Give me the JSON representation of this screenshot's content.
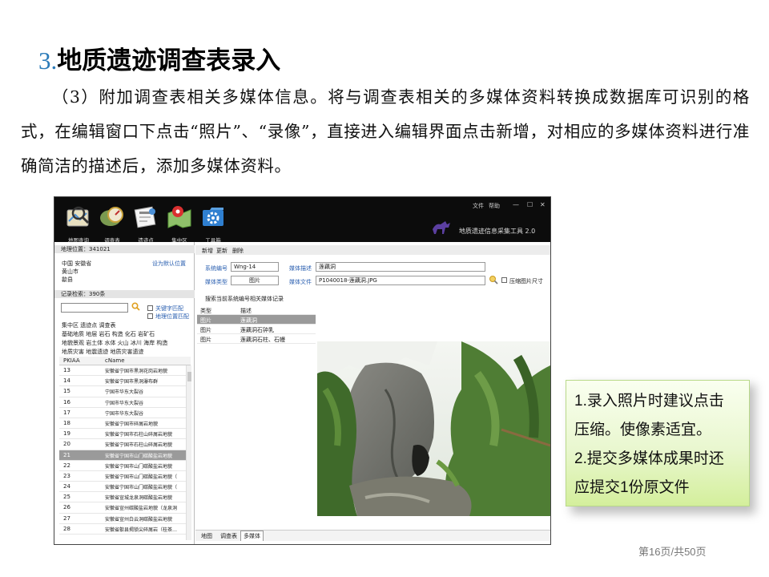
{
  "slide": {
    "title_num": "3.",
    "title_text": "地质遗迹调查表录入",
    "paragraph": "（3）附加调查表相关多媒体信息。将与调查表相关的多媒体资料转换成数据库可识别的格式，在编辑窗口下点击“照片”、“录像”，直接进入编辑界面点击新增，对相应的多媒体资料进行准确简洁的描述后，添加多媒体资料。",
    "page_number": "第16页/共50页"
  },
  "app": {
    "toolbar": [
      {
        "label": "地图查询",
        "icon": "map-search-icon",
        "color": "#4a8fd6"
      },
      {
        "label": "调查表",
        "icon": "survey-form-icon",
        "color": "#c9a23a"
      },
      {
        "label": "遗迹点",
        "icon": "site-point-icon",
        "color": "#d9d9d9"
      },
      {
        "label": "集中区",
        "icon": "concentrated-area-icon",
        "color": "#5a9a3a"
      },
      {
        "label": "工具箱",
        "icon": "toolbox-gear-icon",
        "color": "#2f7fd0"
      }
    ],
    "menu": {
      "file": "文件",
      "help": "帮助"
    },
    "window_buttons": {
      "min": "—",
      "max": "☐",
      "close": "✕"
    },
    "app_name": "地质遗迹信息采集工具 2.0",
    "left": {
      "location_label": "地理位置：341021",
      "location_lines": [
        "中国  安徽省",
        "黄山市",
        "歙县"
      ],
      "set_default": "设为默认位置",
      "record_label": "记录检索：390条",
      "keyword_match": "关键字匹配",
      "geo_match": "地理位置匹配",
      "categories": [
        "集中区  遗迹点  调查表",
        "基础地质  地层  岩石  构造  化石  岩矿石",
        "地貌景观  岩土体  水体  火山  冰川  海岸  构造",
        "地质灾害  地震遗迹  地质灾害遗迹"
      ],
      "grid_headers": {
        "c1": "PKIAA",
        "c2": "cName"
      },
      "rows": [
        {
          "id": "13",
          "name": "安徽省宁国市黑洞花岗岩地貌"
        },
        {
          "id": "14",
          "name": "安徽省宁国市黑洞瀑布群"
        },
        {
          "id": "15",
          "name": "宁国市华东大裂谷"
        },
        {
          "id": "16",
          "name": "宁国市华东大裂谷"
        },
        {
          "id": "17",
          "name": "宁国市华东大裂谷"
        },
        {
          "id": "18",
          "name": "安徽省宁国市碎屑岩地貌"
        },
        {
          "id": "19",
          "name": "安徽省宁国市石柱山碎屑岩地貌"
        },
        {
          "id": "20",
          "name": "安徽省宁国市石柱山碎屑岩地貌"
        },
        {
          "id": "21",
          "name": "安徽省宁国市山门碳酸盐岩地貌"
        },
        {
          "id": "22",
          "name": "安徽省宁国市山门碳酸盐岩地貌"
        },
        {
          "id": "23",
          "name": "安徽省宁国市山门碳酸盐岩地貌（"
        },
        {
          "id": "24",
          "name": "安徽省宁国市山门碳酸盐岩地貌（"
        },
        {
          "id": "25",
          "name": "安徽省宣城龙泉洞碳酸盐岩地貌"
        },
        {
          "id": "26",
          "name": "安徽省宣州碳酸盐岩地貌（龙泉洞"
        },
        {
          "id": "27",
          "name": "安徽省宣州白云洞碳酸盐岩地貌"
        },
        {
          "id": "28",
          "name": "安徽省歙县揭锁尖碎屑岩（桂茶…"
        }
      ],
      "selected_row": 8
    },
    "right": {
      "toolbar": {
        "add": "新增",
        "update": "更新",
        "delete": "删除"
      },
      "sys_no_label": "系统编号",
      "sys_no_value": "Wng-14",
      "media_desc_label": "媒体描述",
      "media_desc_value": "莲藕洞",
      "media_type_label": "媒体类型",
      "media_type_value": "图片",
      "media_file_label": "媒体文件",
      "media_file_value": "P1040018-莲藕洞.JPG",
      "compress_label": "压缩图片尺寸",
      "hint": "搜索当前系统编号相关媒体记录",
      "media_headers": {
        "type": "类型",
        "desc": "描述"
      },
      "media_rows": [
        {
          "type": "图片",
          "desc": "莲藕洞"
        },
        {
          "type": "图片",
          "desc": "莲藕洞石钟乳"
        },
        {
          "type": "图片",
          "desc": "莲藕洞石柱、石幔"
        }
      ],
      "bottom_tabs": [
        "地图",
        "调查表",
        "多媒体"
      ]
    }
  },
  "callout": {
    "lines": [
      "1.录入照片时建议点击",
      "压缩。使像素适宜。",
      "2.提交多媒体成果时还",
      "应提交1份原文件"
    ]
  }
}
